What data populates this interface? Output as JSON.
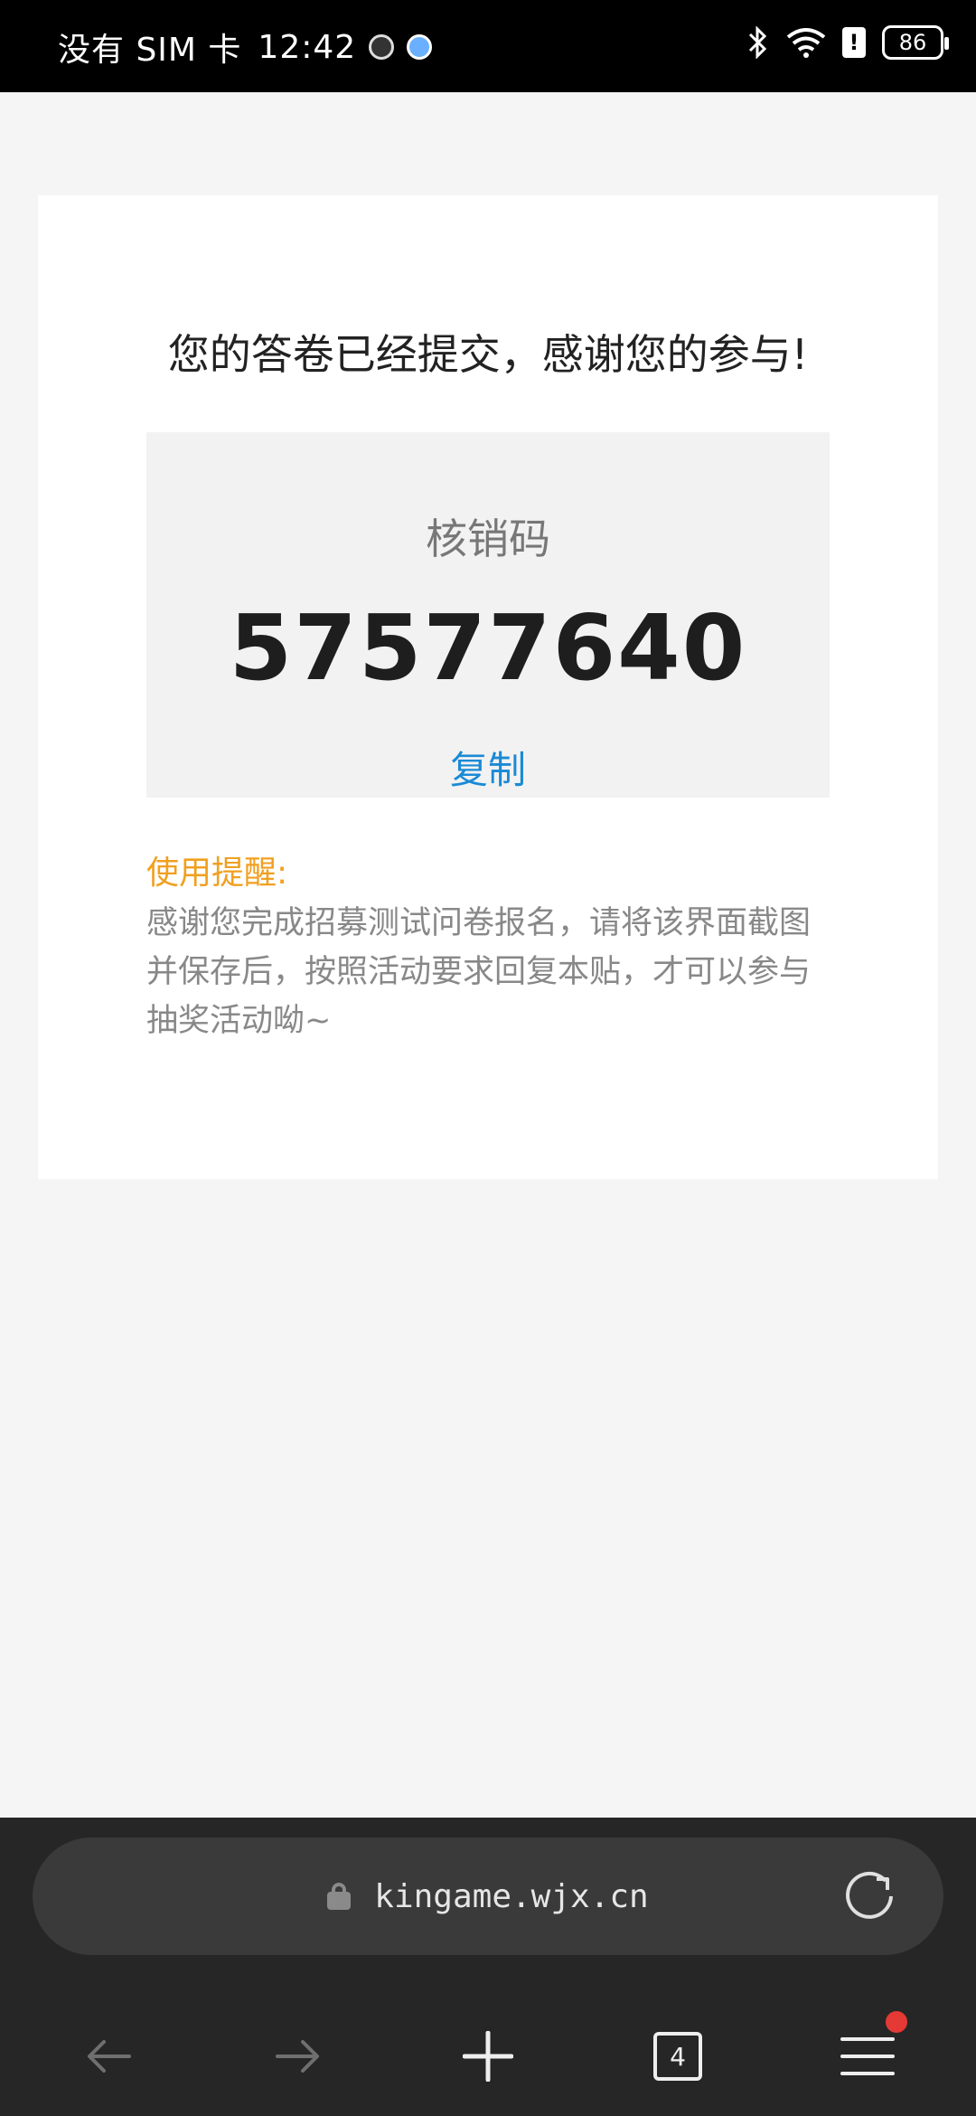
{
  "status_bar": {
    "carrier": "没有 SIM 卡",
    "time": "12:42",
    "battery": "86"
  },
  "page": {
    "thanks_message": "您的答卷已经提交，感谢您的参与!",
    "code_label": "核销码",
    "code_value": "57577640",
    "copy_label": "复制",
    "tip_title": "使用提醒:",
    "tip_text": "感谢您完成招募测试问卷报名，请将该界面截图并保存后，按照活动要求回复本贴，才可以参与抽奖活动呦~"
  },
  "browser": {
    "url": "kingame.wjx.cn",
    "tab_count": "4"
  },
  "colors": {
    "copy_link": "#1a8ad6",
    "tip_title": "#f0a020",
    "notification_dot": "#e53935"
  },
  "icons": [
    "lock-icon",
    "reload-icon",
    "back-arrow-icon",
    "forward-arrow-icon",
    "plus-icon",
    "menu-icon",
    "bluetooth-icon",
    "wifi-icon"
  ]
}
